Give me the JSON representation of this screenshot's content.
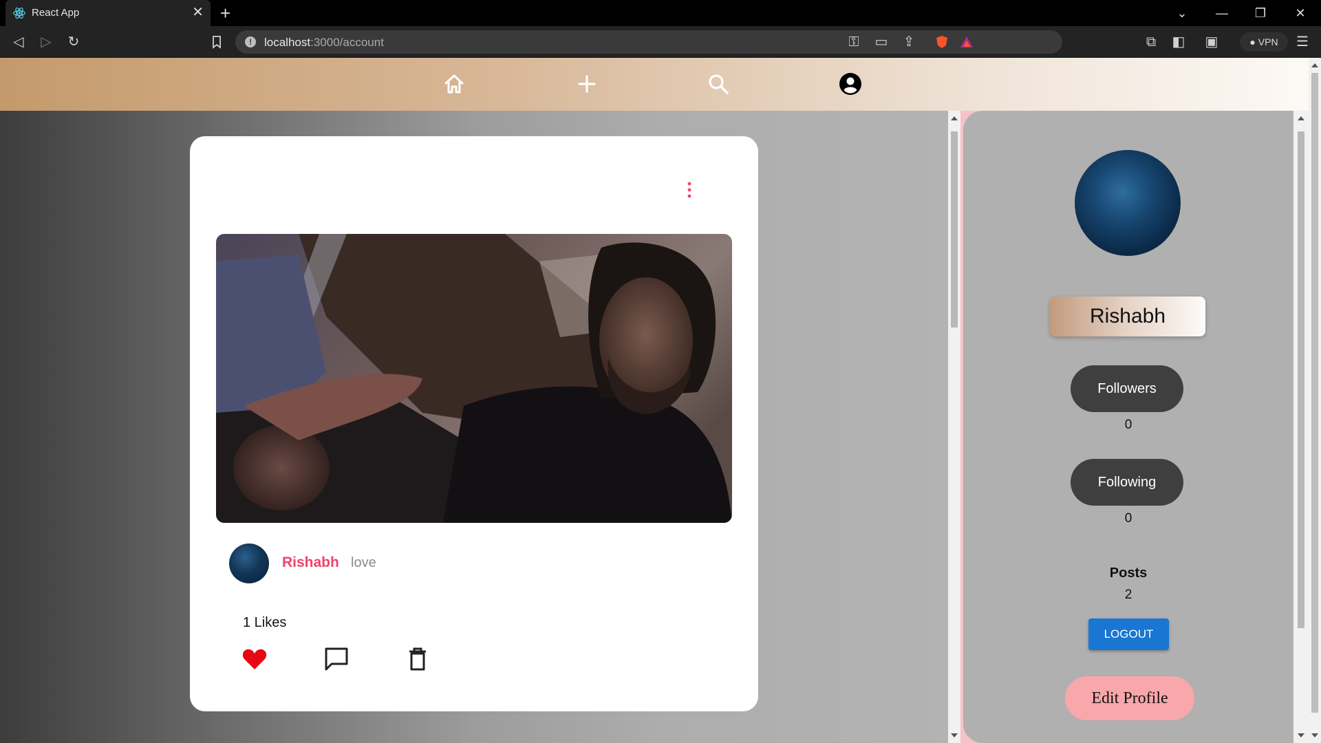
{
  "browser": {
    "tab_title": "React App",
    "url_host": "localhost",
    "url_path": ":3000/account",
    "vpn_label": "VPN"
  },
  "nav": {
    "icons": [
      "home-icon",
      "add-icon",
      "search-icon",
      "account-icon"
    ]
  },
  "post": {
    "username": "Rishabh",
    "caption": "love",
    "likes_text": "1 Likes",
    "liked": true,
    "actions": [
      "like-heart-icon",
      "comment-icon",
      "delete-icon"
    ]
  },
  "profile": {
    "name": "Rishabh",
    "followers_label": "Followers",
    "followers_count": "0",
    "following_label": "Following",
    "following_count": "0",
    "posts_label": "Posts",
    "posts_count": "2",
    "logout_label": "LOGOUT",
    "edit_label": "Edit Profile"
  },
  "colors": {
    "accent_pink": "#f0436a",
    "logout_blue": "#1976d2",
    "edit_button": "#f8a7ab",
    "heart_red": "#e50914"
  }
}
